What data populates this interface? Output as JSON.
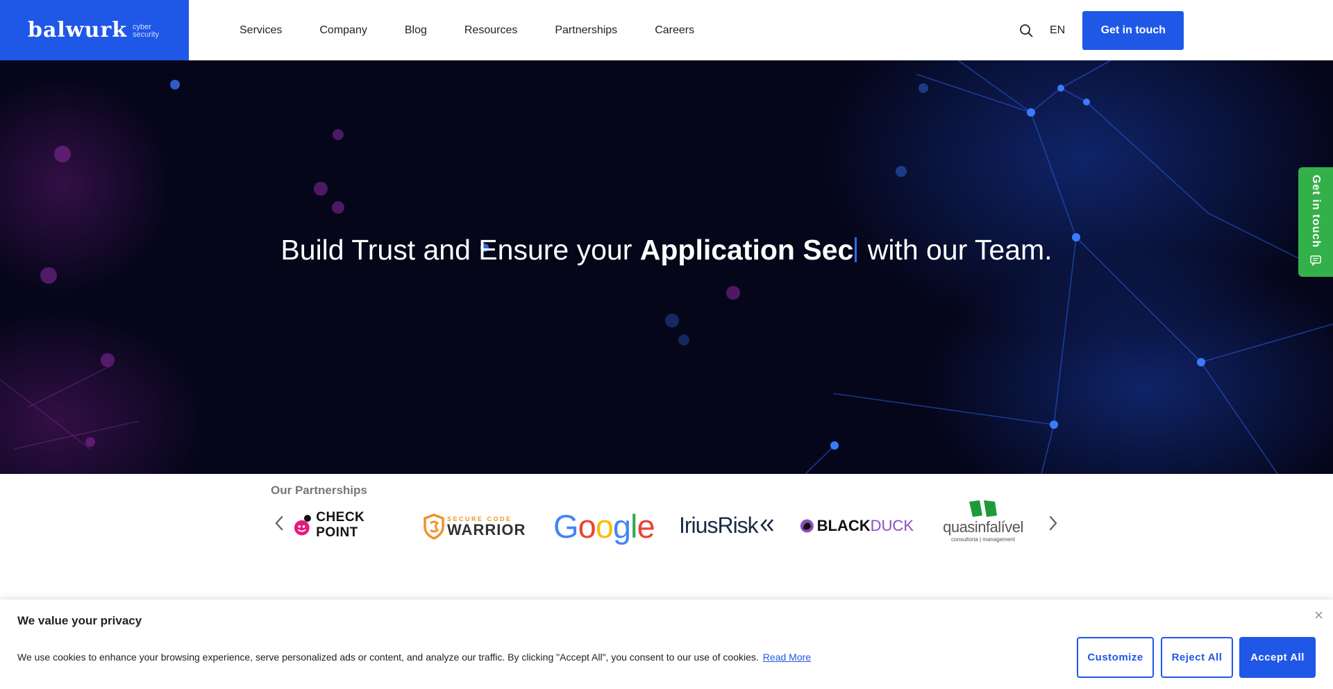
{
  "header": {
    "logo_word": "balwurk",
    "logo_sub_1": "cyber",
    "logo_sub_2": "security",
    "nav": [
      "Services",
      "Company",
      "Blog",
      "Resources",
      "Partnerships",
      "Careers"
    ],
    "language": "EN",
    "cta_label": "Get in touch"
  },
  "hero": {
    "title_prefix": "Build Trust and Ensure your ",
    "title_bold": "Application Sec",
    "title_suffix": " with our Team."
  },
  "side_tab": {
    "label": "Get in touch"
  },
  "partners": {
    "title": "Our Partnerships",
    "logos": [
      {
        "name": "checkpoint",
        "text": "CHECK POINT"
      },
      {
        "name": "securecodewarrior",
        "text_top": "SECURE CODE",
        "text_main": "WARRIOR"
      },
      {
        "name": "google",
        "letters": [
          "G",
          "o",
          "o",
          "g",
          "l",
          "e"
        ]
      },
      {
        "name": "iriusrisk",
        "text": "IriusRisk"
      },
      {
        "name": "blackduck",
        "text_bold": "BLACK",
        "text_light": "DUCK"
      },
      {
        "name": "quasinfalivel",
        "text": "quasinfalível",
        "subtext": "consultoria | management"
      }
    ],
    "colors": {
      "google": [
        "#4285f4",
        "#ea4335",
        "#fbbc05",
        "#4285f4",
        "#34a853",
        "#ea4335"
      ]
    }
  },
  "cookie": {
    "title": "We value your privacy",
    "text": "We use cookies to enhance your browsing experience, serve personalized ads or content, and analyze our traffic. By clicking \"Accept All\", you consent to our use of cookies.",
    "read_more": "Read More",
    "customize": "Customize",
    "reject": "Reject All",
    "accept": "Accept All"
  },
  "theme": {
    "brand": "#1f57e7",
    "side_tab": "#34b04a",
    "hero_bg": "#05061a"
  }
}
